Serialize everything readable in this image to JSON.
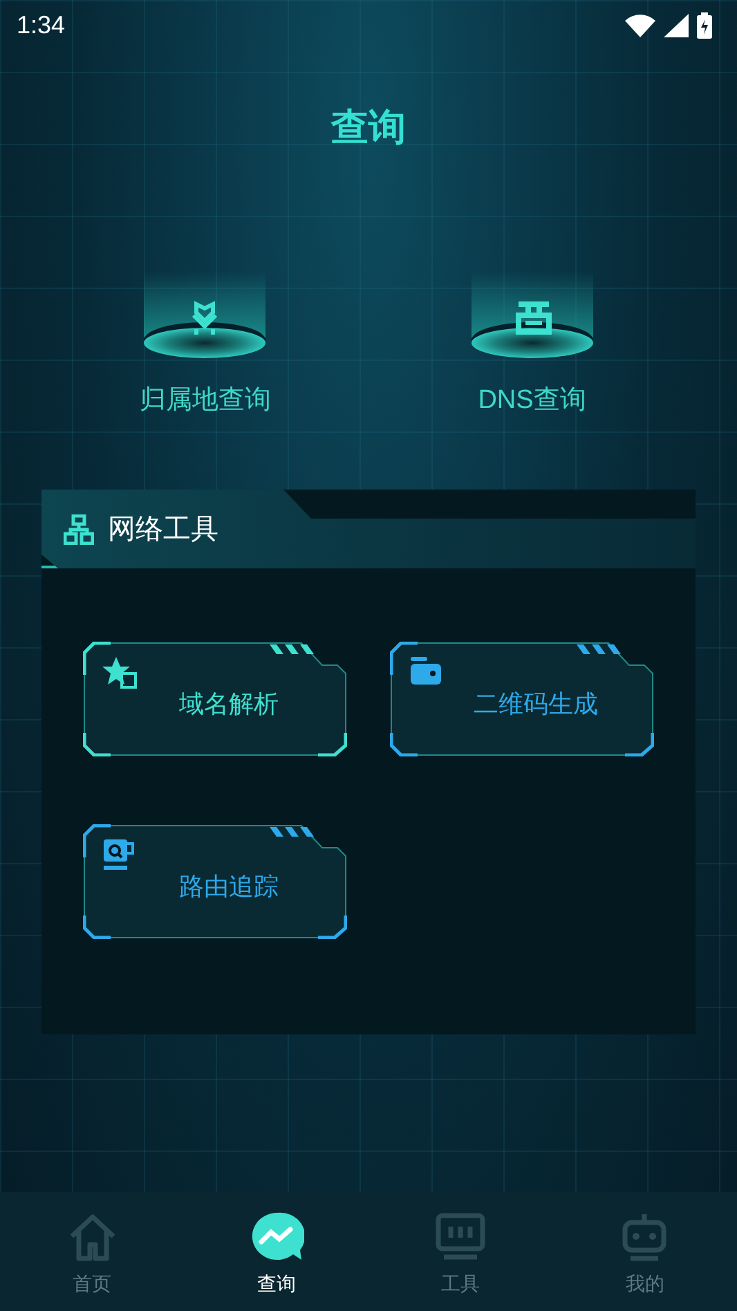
{
  "status_bar": {
    "time": "1:34"
  },
  "title": "查询",
  "queries": [
    {
      "label": "归属地查询"
    },
    {
      "label": "DNS查询"
    }
  ],
  "panel": {
    "title": "网络工具",
    "tools": [
      {
        "label": "域名解析",
        "color": "#3ee0cf"
      },
      {
        "label": "二维码生成",
        "color": "#2ea9ea"
      },
      {
        "label": "路由追踪",
        "color": "#2ea9ea"
      }
    ]
  },
  "tabs": [
    {
      "label": "首页",
      "selected": false
    },
    {
      "label": "查询",
      "selected": true
    },
    {
      "label": "工具",
      "selected": false
    },
    {
      "label": "我的",
      "selected": false
    }
  ]
}
